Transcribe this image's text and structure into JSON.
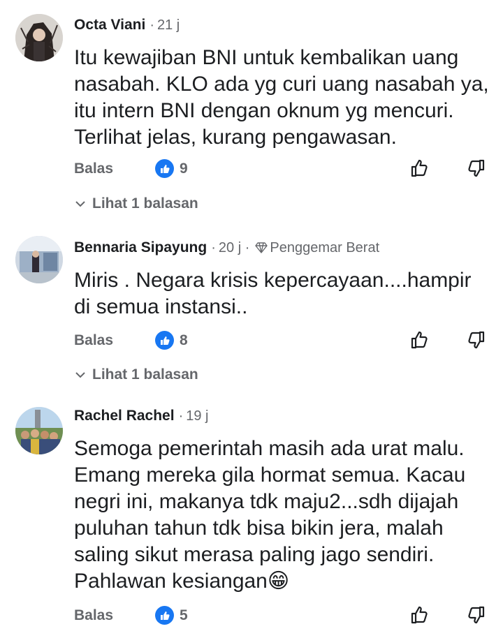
{
  "comments": [
    {
      "author": "Octa Viani",
      "time": "21 j",
      "badge": "",
      "text": "Itu kewajiban BNI untuk kembalikan uang nasabah. KLO ada yg curi uang nasabah ya, itu intern BNI dengan oknum yg mencuri. Terlihat jelas, kurang pengawasan.",
      "reply_label": "Balas",
      "like_count": "9",
      "view_replies": "Lihat 1 balasan"
    },
    {
      "author": "Bennaria Sipayung",
      "time": "20 j",
      "badge": "Penggemar Berat",
      "text": "Miris . Negara krisis kepercayaan....hampir di semua instansi..",
      "reply_label": "Balas",
      "like_count": "8",
      "view_replies": "Lihat 1 balasan"
    },
    {
      "author": "Rachel Rachel",
      "time": "19 j",
      "badge": "",
      "text": "Semoga pemerintah masih ada urat malu. Emang mereka gila hormat semua. Kacau negri ini, makanya tdk maju2...sdh dijajah puluhan tahun tdk bisa bikin jera, malah saling sikut merasa paling jago sendiri. Pahlawan kesiangan😁",
      "reply_label": "Balas",
      "like_count": "5",
      "view_replies": ""
    }
  ],
  "icons": {
    "like_reaction": "like-reaction-icon",
    "upvote": "thumbs-up-outline-icon",
    "downvote": "thumbs-down-outline-icon",
    "chevron": "chevron-down-icon",
    "diamond": "diamond-icon"
  },
  "colors": {
    "like_blue": "#1877f2",
    "meta_gray": "#65676b",
    "text": "#1c1e21"
  }
}
